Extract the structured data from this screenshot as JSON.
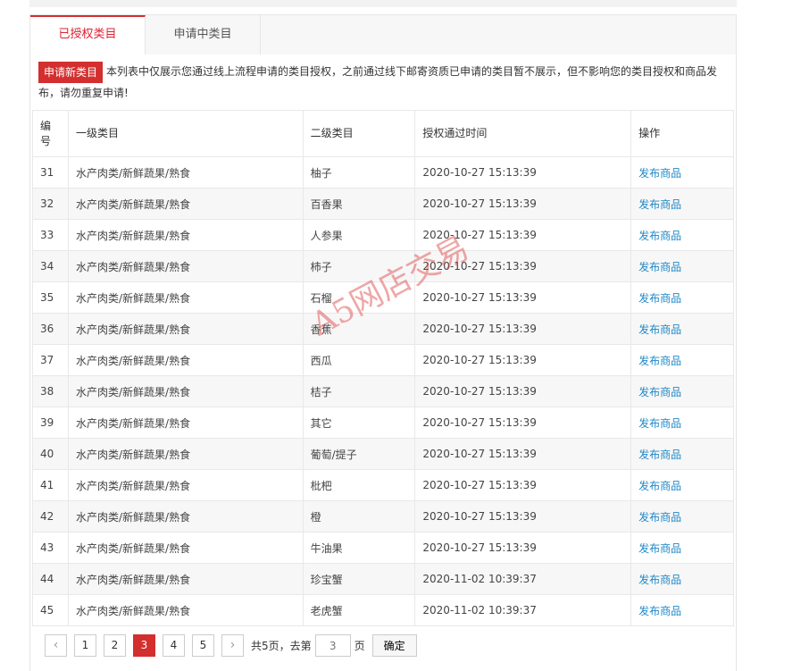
{
  "tabs": [
    {
      "label": "已授权类目",
      "active": true
    },
    {
      "label": "申请中类目",
      "active": false
    }
  ],
  "notice": {
    "button_label": "申请新类目",
    "text": "本列表中仅展示您通过线上流程申请的类目授权，之前通过线下邮寄资质已申请的类目暂不展示，但不影响您的类目授权和商品发布，请勿重复申请!"
  },
  "table": {
    "headers": [
      "编号",
      "一级类目",
      "二级类目",
      "授权通过时间",
      "操作"
    ],
    "rows": [
      {
        "id": "31",
        "cat1": "水产肉类/新鲜蔬果/熟食",
        "cat2": "柚子",
        "time": "2020-10-27 15:13:39",
        "action": "发布商品"
      },
      {
        "id": "32",
        "cat1": "水产肉类/新鲜蔬果/熟食",
        "cat2": "百香果",
        "time": "2020-10-27 15:13:39",
        "action": "发布商品"
      },
      {
        "id": "33",
        "cat1": "水产肉类/新鲜蔬果/熟食",
        "cat2": "人参果",
        "time": "2020-10-27 15:13:39",
        "action": "发布商品"
      },
      {
        "id": "34",
        "cat1": "水产肉类/新鲜蔬果/熟食",
        "cat2": "柿子",
        "time": "2020-10-27 15:13:39",
        "action": "发布商品"
      },
      {
        "id": "35",
        "cat1": "水产肉类/新鲜蔬果/熟食",
        "cat2": "石榴",
        "time": "2020-10-27 15:13:39",
        "action": "发布商品"
      },
      {
        "id": "36",
        "cat1": "水产肉类/新鲜蔬果/熟食",
        "cat2": "香蕉",
        "time": "2020-10-27 15:13:39",
        "action": "发布商品"
      },
      {
        "id": "37",
        "cat1": "水产肉类/新鲜蔬果/熟食",
        "cat2": "西瓜",
        "time": "2020-10-27 15:13:39",
        "action": "发布商品"
      },
      {
        "id": "38",
        "cat1": "水产肉类/新鲜蔬果/熟食",
        "cat2": "桔子",
        "time": "2020-10-27 15:13:39",
        "action": "发布商品"
      },
      {
        "id": "39",
        "cat1": "水产肉类/新鲜蔬果/熟食",
        "cat2": "其它",
        "time": "2020-10-27 15:13:39",
        "action": "发布商品"
      },
      {
        "id": "40",
        "cat1": "水产肉类/新鲜蔬果/熟食",
        "cat2": "葡萄/提子",
        "time": "2020-10-27 15:13:39",
        "action": "发布商品"
      },
      {
        "id": "41",
        "cat1": "水产肉类/新鲜蔬果/熟食",
        "cat2": "枇杷",
        "time": "2020-10-27 15:13:39",
        "action": "发布商品"
      },
      {
        "id": "42",
        "cat1": "水产肉类/新鲜蔬果/熟食",
        "cat2": "橙",
        "time": "2020-10-27 15:13:39",
        "action": "发布商品"
      },
      {
        "id": "43",
        "cat1": "水产肉类/新鲜蔬果/熟食",
        "cat2": "牛油果",
        "time": "2020-10-27 15:13:39",
        "action": "发布商品"
      },
      {
        "id": "44",
        "cat1": "水产肉类/新鲜蔬果/熟食",
        "cat2": "珍宝蟹",
        "time": "2020-11-02 10:39:37",
        "action": "发布商品"
      },
      {
        "id": "45",
        "cat1": "水产肉类/新鲜蔬果/熟食",
        "cat2": "老虎蟹",
        "time": "2020-11-02 10:39:37",
        "action": "发布商品"
      }
    ]
  },
  "pager": {
    "prev_icon": "chevron-left-icon",
    "next_icon": "chevron-right-icon",
    "pages": [
      "1",
      "2",
      "3",
      "4",
      "5"
    ],
    "current": "3",
    "total_text": "共5页，去第",
    "input_placeholder": "3",
    "page_suffix": "页",
    "confirm_label": "确定"
  },
  "watermark": "A5网店交易",
  "colors": {
    "accent": "#d32f2f",
    "link": "#1e88c8"
  }
}
